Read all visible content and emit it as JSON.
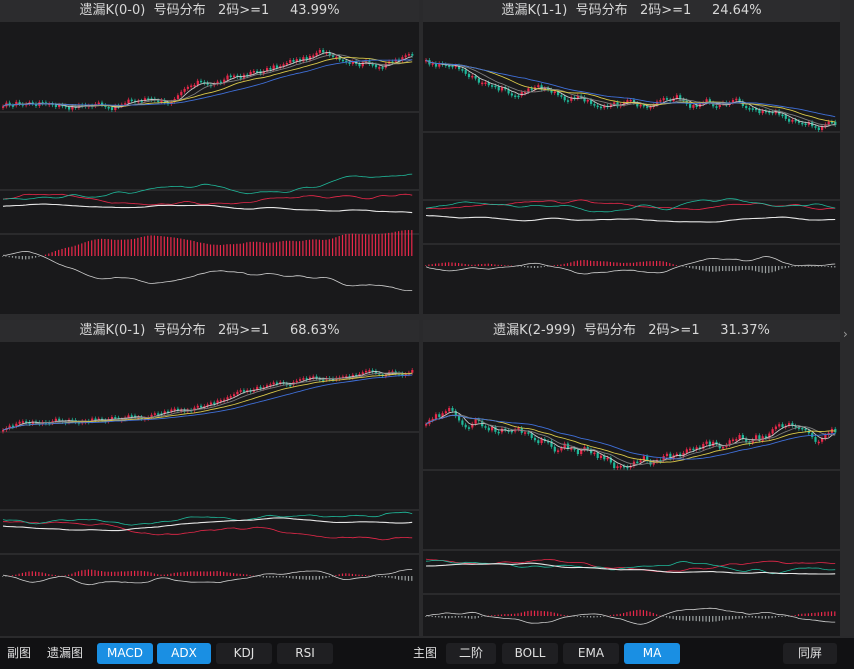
{
  "panels": [
    {
      "id": "p00",
      "title": "遗漏K(0-0)  号码分布   2码>=1     43.99%"
    },
    {
      "id": "p11",
      "title": "遗漏K(1-1)  号码分布   2码>=1     24.64%"
    },
    {
      "id": "p01",
      "title": "遗漏K(0-1)  号码分布   2码>=1     68.63%"
    },
    {
      "id": "p2999",
      "title": "遗漏K(2-999)  号码分布   2码>=1     31.37%"
    }
  ],
  "toolbar": {
    "left_label_1": "副图",
    "left_label_2": "遗漏图",
    "macd": "MACD",
    "adx": "ADX",
    "kdj": "KDJ",
    "rsi": "RSI",
    "main_label": "主图",
    "erjie": "二阶",
    "boll": "BOLL",
    "ema": "EMA",
    "ma": "MA",
    "tongping": "同屏"
  },
  "scroll_glyph": "›",
  "colors": {
    "accent": "#1a8fe3",
    "up": "#e8284a",
    "down": "#1fb89a",
    "panel_bg": "#19191b"
  }
}
